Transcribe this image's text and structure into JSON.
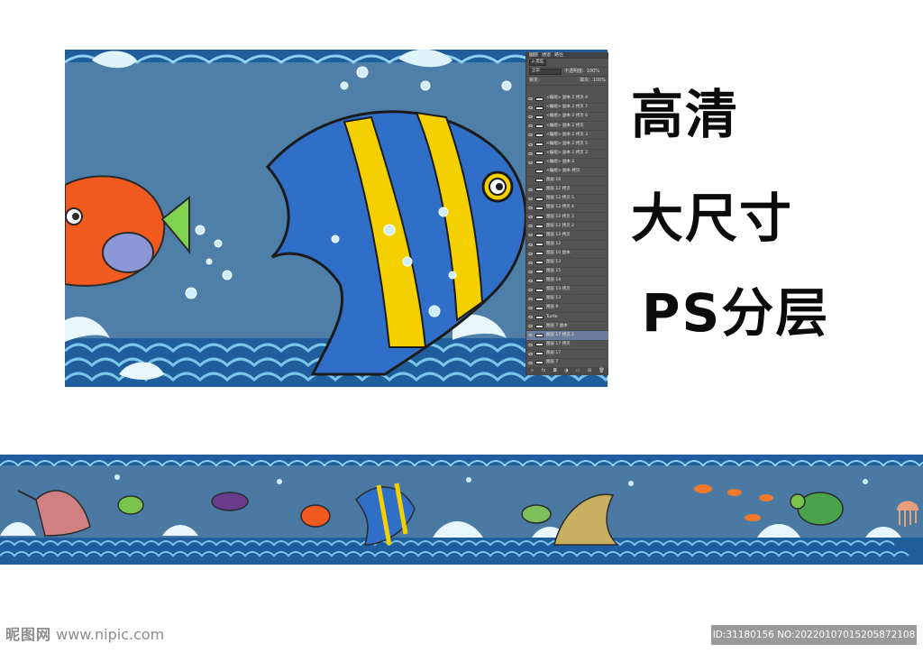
{
  "headline": {
    "line1": "高清",
    "line2": "大尺寸",
    "line3": "PS分层"
  },
  "ps_panel": {
    "tabs": [
      "图层",
      "通道",
      "路径"
    ],
    "active_tab": "图层",
    "filter_label": "ρ 类型",
    "blend_mode": "正常",
    "opacity_label": "不透明度:",
    "opacity_value": "100%",
    "lock_label": "锁定:",
    "fill_label": "填充:",
    "fill_value": "100%",
    "layers": [
      "<编组> 副本 2 拷贝 4",
      "<编组> 副本 2 拷贝 7",
      "<编组> 副本 2 拷贝 6",
      "<编组> 副本 2 拷贝",
      "<编组> 副本 2 拷贝 3",
      "<编组> 副本 2 拷贝 5",
      "<编组> 副本 2 拷贝 2",
      "<编组> 副本 2",
      "<编组> 副本 拷贝",
      "图层 16",
      "图层 12 拷贝",
      "图层 12 拷贝 5",
      "图层 12 拷贝 4",
      "图层 12 拷贝 3",
      "图层 12 拷贝 2",
      "图层 12 拷贝",
      "图层 12",
      "图层 10 副本",
      "图层 13",
      "图层 15",
      "图层 14",
      "图层 13 拷贝",
      "图层 13",
      "图层 9",
      "Turtle",
      "图层 7 副本",
      "图层 17 拷贝 2",
      "图层 17 拷贝",
      "图层 17",
      "图层 7",
      "图层 8",
      "图层 6",
      "shrimp"
    ],
    "selected_layer_index": 26,
    "footer_icons": [
      "link-icon",
      "fx-icon",
      "mask-icon",
      "adjust-icon",
      "folder-icon",
      "new-layer-icon",
      "trash-icon"
    ],
    "footer_glyphs": [
      "∞",
      "fx",
      "◘",
      "◑",
      "▭",
      "⊞",
      "🗑"
    ]
  },
  "watermark": {
    "site_logo": "昵图网",
    "site_url": "www.nipic.com",
    "id_text": "ID:31180156 NO:20220107015205872108"
  },
  "colors": {
    "ocean": "#4d7fa8",
    "wave_dark": "#1e5a9a",
    "wave_light": "#8fd0ef",
    "fish_blue": "#2f6fc7",
    "fish_yellow": "#f5d000",
    "ps_panel": "#535353"
  }
}
